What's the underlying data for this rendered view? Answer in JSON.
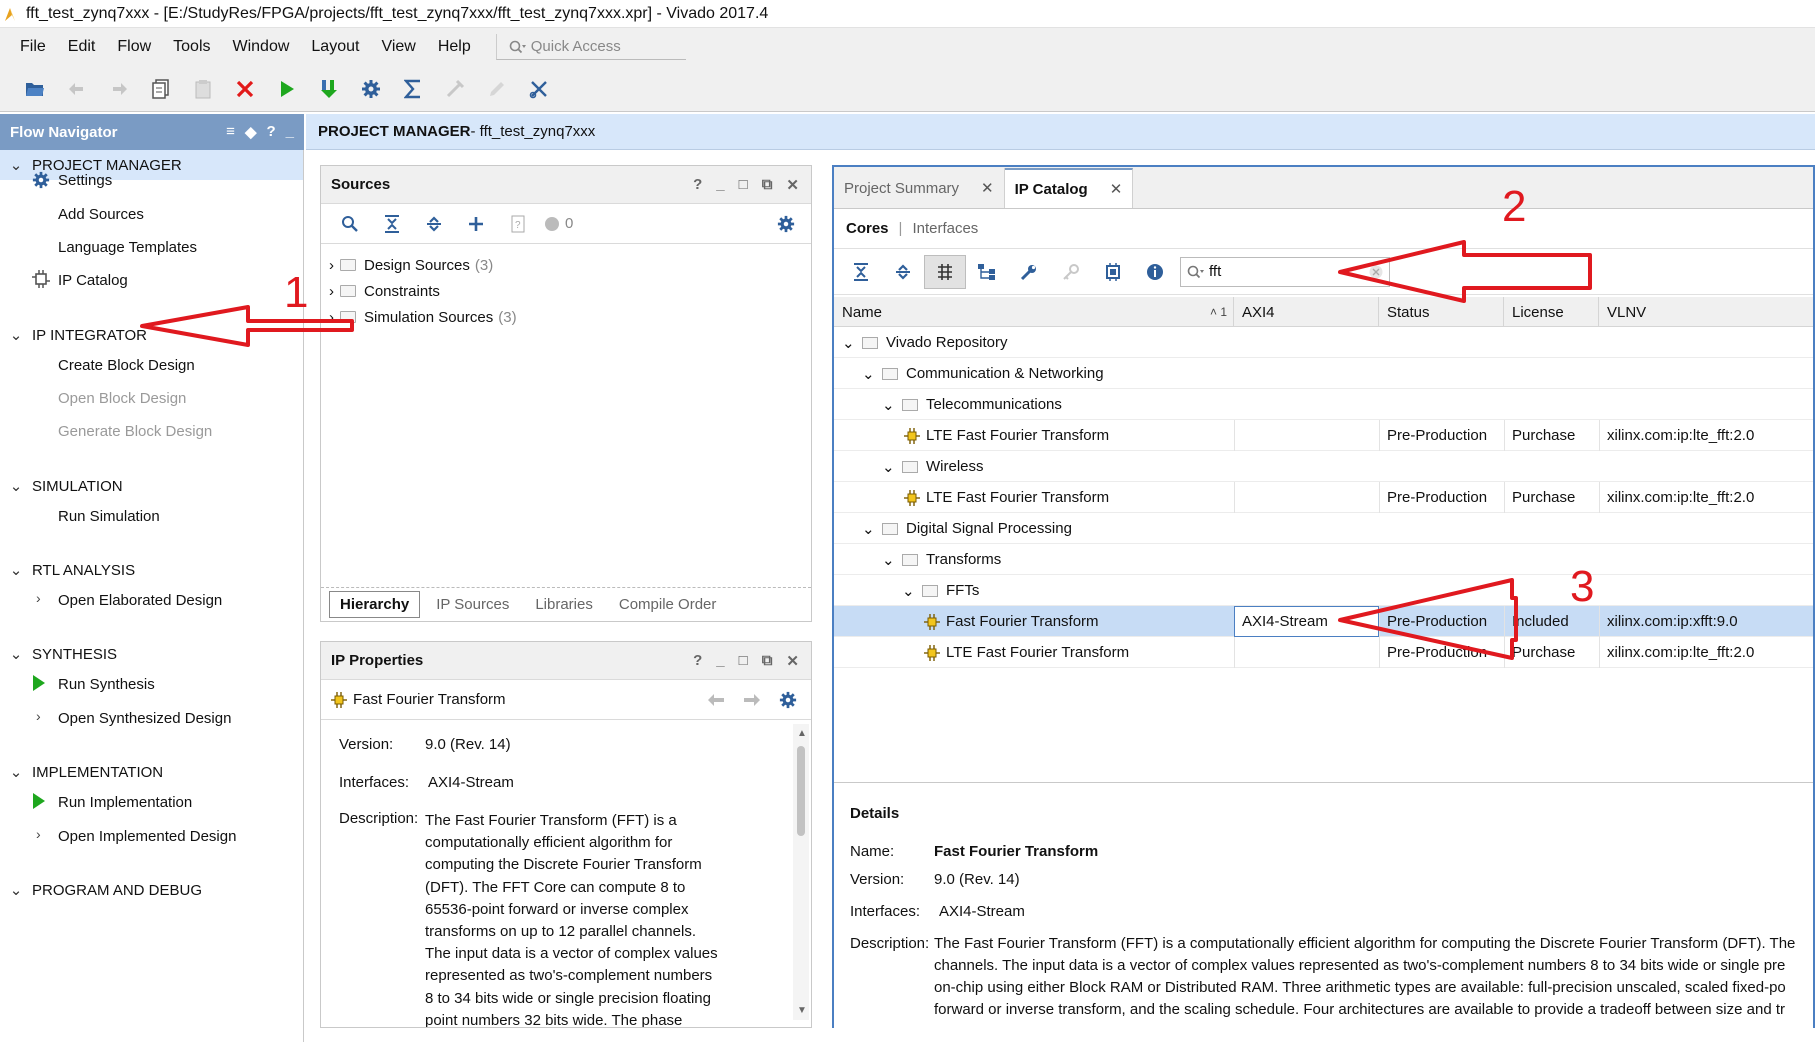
{
  "window": {
    "title": "fft_test_zynq7xxx - [E:/StudyRes/FPGA/projects/fft_test_zynq7xxx/fft_test_zynq7xxx.xpr] - Vivado 2017.4"
  },
  "menubar": {
    "items": [
      "File",
      "Edit",
      "Flow",
      "Tools",
      "Window",
      "Layout",
      "View",
      "Help"
    ],
    "quick_access_placeholder": "Quick Access"
  },
  "toolbar": {
    "icons": [
      "open-project-icon",
      "undo-icon",
      "redo-icon",
      "copy-icon",
      "paste-icon",
      "delete-icon",
      "run-icon",
      "program-icon",
      "settings-icon",
      "sigma-icon",
      "disabled-tool-icon",
      "disabled-pencil-icon",
      "cut-icon"
    ]
  },
  "flow_navigator": {
    "title": "Flow Navigator",
    "controls": [
      "≡",
      "◆",
      "?",
      "_"
    ],
    "sections": [
      {
        "label": "PROJECT MANAGER",
        "items": [
          "Settings",
          "Add Sources",
          "Language Templates",
          "IP Catalog"
        ]
      },
      {
        "label": "IP INTEGRATOR",
        "items": [
          "Create Block Design",
          "Open Block Design",
          "Generate Block Design"
        ]
      },
      {
        "label": "SIMULATION",
        "items": [
          "Run Simulation"
        ]
      },
      {
        "label": "RTL ANALYSIS",
        "items": [
          "Open Elaborated Design"
        ]
      },
      {
        "label": "SYNTHESIS",
        "items": [
          "Run Synthesis",
          "Open Synthesized Design"
        ]
      },
      {
        "label": "IMPLEMENTATION",
        "items": [
          "Run Implementation",
          "Open Implemented Design"
        ]
      },
      {
        "label": "PROGRAM AND DEBUG",
        "items": []
      }
    ]
  },
  "project_manager": {
    "label": "PROJECT MANAGER",
    "project": " - fft_test_zynq7xxx"
  },
  "sources": {
    "title": "Sources",
    "controls": [
      "?",
      "_",
      "□",
      "⧉",
      "✕"
    ],
    "error_count": "0",
    "tree": [
      {
        "label": "Design Sources",
        "count": "(3)"
      },
      {
        "label": "Constraints",
        "count": ""
      },
      {
        "label": "Simulation Sources",
        "count": "(3)"
      }
    ],
    "tabs": [
      "Hierarchy",
      "IP Sources",
      "Libraries",
      "Compile Order"
    ]
  },
  "ip_properties": {
    "title": "IP Properties",
    "controls": [
      "?",
      "_",
      "□",
      "⧉",
      "✕"
    ],
    "selected": "Fast Fourier Transform",
    "version_label": "Version:",
    "version": "9.0 (Rev. 14)",
    "interfaces_label": "Interfaces:",
    "interfaces": "AXI4-Stream",
    "description_label": "Description:",
    "description_lines": [
      "The Fast Fourier Transform (FFT) is a",
      "computationally efficient algorithm for",
      "computing the Discrete Fourier Transform",
      "(DFT). The FFT Core can compute 8 to",
      "65536-point forward or inverse complex",
      "transforms on up to 12 parallel channels.",
      "The input data is a vector of complex values",
      "represented as two's-complement numbers",
      "8 to 34 bits wide or single precision floating",
      "point numbers 32 bits wide. The phase"
    ]
  },
  "ip_catalog": {
    "tabs": [
      {
        "label": "Project Summary"
      },
      {
        "label": "IP Catalog"
      }
    ],
    "subtabs": [
      "Cores",
      "Interfaces"
    ],
    "search_value": "fft",
    "columns": [
      "Name",
      "AXI4",
      "Status",
      "License",
      "VLNV"
    ],
    "sort_indicator": "˄ 1",
    "rows": [
      {
        "depth": 0,
        "kind": "folder",
        "name": "Vivado Repository"
      },
      {
        "depth": 1,
        "kind": "folder",
        "name": "Communication & Networking"
      },
      {
        "depth": 2,
        "kind": "folder",
        "name": "Telecommunications"
      },
      {
        "depth": 3,
        "kind": "ip",
        "name": "LTE Fast Fourier Transform",
        "axi4": "",
        "status": "Pre-Production",
        "license": "Purchase",
        "vlnv": "xilinx.com:ip:lte_fft:2.0"
      },
      {
        "depth": 2,
        "kind": "folder",
        "name": "Wireless"
      },
      {
        "depth": 3,
        "kind": "ip",
        "name": "LTE Fast Fourier Transform",
        "axi4": "",
        "status": "Pre-Production",
        "license": "Purchase",
        "vlnv": "xilinx.com:ip:lte_fft:2.0"
      },
      {
        "depth": 1,
        "kind": "folder",
        "name": "Digital Signal Processing"
      },
      {
        "depth": 2,
        "kind": "folder",
        "name": "Transforms"
      },
      {
        "depth": 3,
        "kind": "folder",
        "name": "FFTs"
      },
      {
        "depth": 4,
        "kind": "ip",
        "name": "Fast Fourier Transform",
        "axi4": "AXI4-Stream",
        "status": "Pre-Production",
        "license": "Included",
        "vlnv": "xilinx.com:ip:xfft:9.0",
        "selected": true
      },
      {
        "depth": 4,
        "kind": "ip",
        "name": "LTE Fast Fourier Transform",
        "axi4": "",
        "status": "Pre-Production",
        "license": "Purchase",
        "vlnv": "xilinx.com:ip:lte_fft:2.0"
      }
    ],
    "details": {
      "title": "Details",
      "name_label": "Name:",
      "name": "Fast Fourier Transform",
      "version_label": "Version:",
      "version": "9.0 (Rev. 14)",
      "interfaces_label": "Interfaces:",
      "interfaces": "AXI4-Stream",
      "description_label": "Description:",
      "description_lines": [
        "The Fast Fourier Transform (FFT) is a computationally efficient algorithm for computing the Discrete Fourier Transform (DFT). The",
        "channels. The input data is a vector of complex values represented as two's-complement numbers 8 to 34 bits wide or single pre",
        "on-chip using either Block RAM or Distributed RAM. Three arithmetic types are available: full-precision unscaled, scaled fixed-po",
        "forward or inverse transform, and the scaling schedule. Four architectures are available to provide a tradeoff between size and tr"
      ]
    }
  },
  "annotations": {
    "numbers": [
      "1",
      "2",
      "3"
    ],
    "color": "#e0191f"
  },
  "colors": {
    "flow_nav_header": "#7a9bc4",
    "pm_header": "#d7e7fa",
    "selection": "#c7dcf5",
    "catalog_border": "#4b7fc2",
    "run_green": "#1ea71e"
  }
}
